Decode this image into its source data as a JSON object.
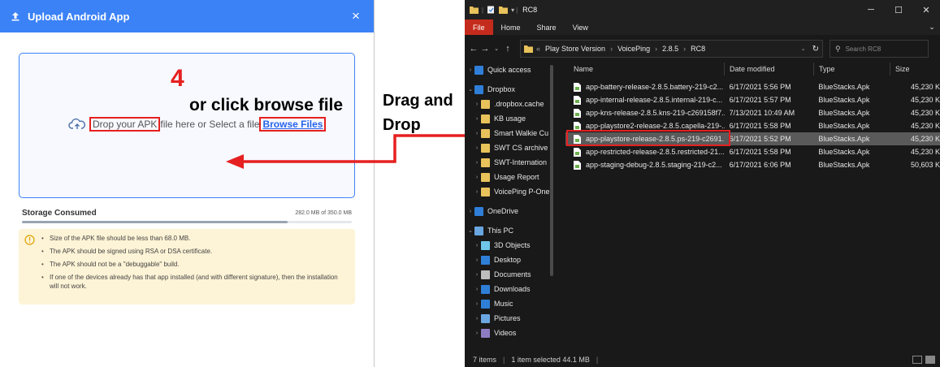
{
  "colors": {
    "accent": "#3b82f6",
    "annotation_red": "#e62020",
    "explorer_bg": "#191919",
    "file_tab": "#c42b1c",
    "warning_bg": "#fdf3d6"
  },
  "upload_dialog": {
    "title": "Upload Android App",
    "close_icon": "close-icon",
    "drop_prefix": "Drop your APK",
    "drop_middle": " file here or Select a file ",
    "browse_label": "Browse Files",
    "storage_label": "Storage Consumed",
    "storage_value": "282.0 MB of 350.0 MB",
    "storage_fraction": 0.806,
    "notes": [
      "Size of the APK file should be less than 68.0 MB.",
      "The APK should be signed using RSA or DSA certificate.",
      "The APK should not be a \"debuggable\" build.",
      "If one of the devices already has that app installed (and with different signature), then the installation will not work."
    ]
  },
  "annotations": {
    "step_number": "4",
    "browse_hint": "or click browse file",
    "drag_line1": "Drag and",
    "drag_line2": "Drop"
  },
  "explorer": {
    "window_title": "RC8",
    "ribbon_tabs": [
      "File",
      "Home",
      "Share",
      "View"
    ],
    "breadcrumbs": [
      "Play Store Version",
      "VoicePing",
      "2.8.5",
      "RC8"
    ],
    "search_placeholder": "Search RC8",
    "columns": [
      "Name",
      "Date modified",
      "Type",
      "Size"
    ],
    "nav_items": [
      {
        "label": "Quick access",
        "icon": "star-icon",
        "color": "#2f7fd8"
      },
      {
        "label": "Dropbox",
        "icon": "dropbox-icon",
        "color": "#2f7fd8"
      },
      {
        "label": ".dropbox.cache",
        "icon": "folder-icon",
        "color": "#e8c25a"
      },
      {
        "label": "KB usage",
        "icon": "folder-icon",
        "color": "#e8c25a"
      },
      {
        "label": "Smart Walkie Cu",
        "icon": "folder-icon",
        "color": "#e8c25a"
      },
      {
        "label": "SWT CS archive",
        "icon": "folder-icon",
        "color": "#e8c25a"
      },
      {
        "label": "SWT-Internation",
        "icon": "folder-icon",
        "color": "#e8c25a"
      },
      {
        "label": "Usage Report",
        "icon": "folder-icon",
        "color": "#e8c25a"
      },
      {
        "label": "VoicePing P-One",
        "icon": "folder-icon",
        "color": "#e8c25a"
      },
      {
        "label": "OneDrive",
        "icon": "cloud-icon",
        "color": "#2f7fd8"
      },
      {
        "label": "This PC",
        "icon": "computer-icon",
        "color": "#6aa6e0"
      },
      {
        "label": "3D Objects",
        "icon": "cube-icon",
        "color": "#6ec6e8"
      },
      {
        "label": "Desktop",
        "icon": "desktop-icon",
        "color": "#2f7fd8"
      },
      {
        "label": "Documents",
        "icon": "document-icon",
        "color": "#bdbdbd"
      },
      {
        "label": "Downloads",
        "icon": "download-icon",
        "color": "#2f7fd8"
      },
      {
        "label": "Music",
        "icon": "music-icon",
        "color": "#2f7fd8"
      },
      {
        "label": "Pictures",
        "icon": "pictures-icon",
        "color": "#6aa6e0"
      },
      {
        "label": "Videos",
        "icon": "video-icon",
        "color": "#8e7cc3"
      }
    ],
    "files": [
      {
        "name": "app-battery-release-2.8.5.battery-219-c2...",
        "date": "6/17/2021 5:56 PM",
        "type": "BlueStacks.Apk",
        "size": "45,230 K"
      },
      {
        "name": "app-internal-release-2.8.5.internal-219-c...",
        "date": "6/17/2021 5:57 PM",
        "type": "BlueStacks.Apk",
        "size": "45,230 K"
      },
      {
        "name": "app-kns-release-2.8.5.kns-219-c269158f7...",
        "date": "7/13/2021 10:49 AM",
        "type": "BlueStacks.Apk",
        "size": "45,230 K"
      },
      {
        "name": "app-playstore2-release-2.8.5.capella-219-...",
        "date": "6/17/2021 5:58 PM",
        "type": "BlueStacks.Apk",
        "size": "45,230 K"
      },
      {
        "name": "app-playstore-release-2.8.5.ps-219-c2691...",
        "date": "6/17/2021 5:52 PM",
        "type": "BlueStacks.Apk",
        "size": "45,230 K",
        "selected": true
      },
      {
        "name": "app-restricted-release-2.8.5.restricted-21...",
        "date": "6/17/2021 5:58 PM",
        "type": "BlueStacks.Apk",
        "size": "45,230 K"
      },
      {
        "name": "app-staging-debug-2.8.5.staging-219-c2...",
        "date": "6/17/2021 6:06 PM",
        "type": "BlueStacks.Apk",
        "size": "50,603 K"
      }
    ],
    "status_items": "7 items",
    "status_selected": "1 item selected  44.1 MB"
  }
}
